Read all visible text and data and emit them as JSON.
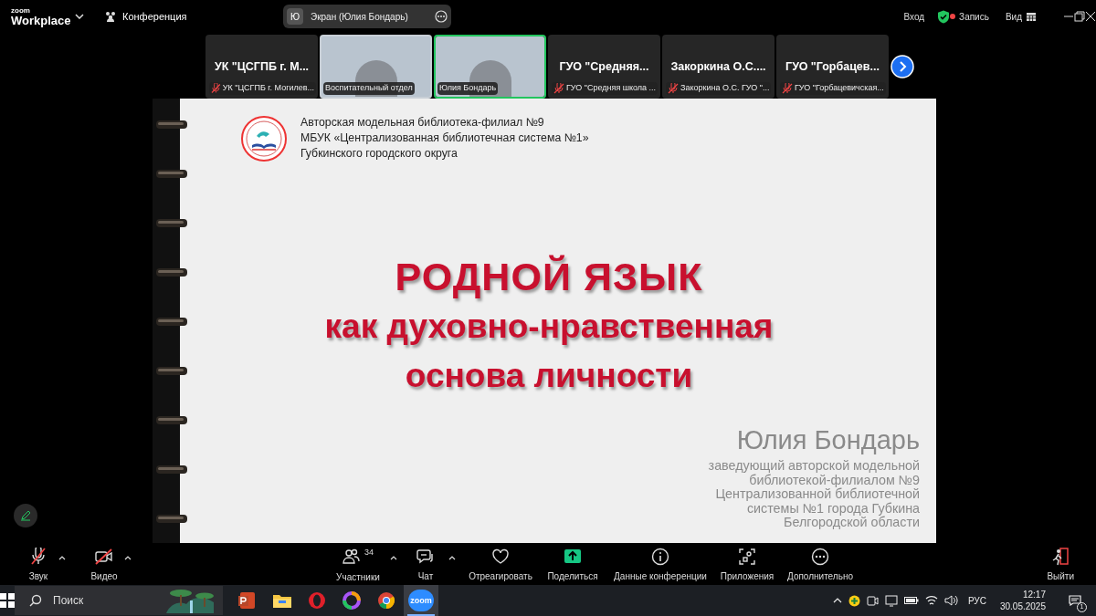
{
  "window": {
    "logo_top": "zoom",
    "logo_bottom": "Workplace",
    "meeting_menu": "Конференция"
  },
  "share_pill": {
    "avatar": "Ю",
    "label": "Экран (Юлия Бондарь)"
  },
  "top_actions": {
    "sign_in": "Вход",
    "recording": "Запись",
    "view": "Вид"
  },
  "participants": [
    {
      "kind": "name",
      "display": "УК \"ЦСГПБ г. М...",
      "label": "УК \"ЦСГПБ г. Могилев...",
      "muted": true,
      "speaking": false
    },
    {
      "kind": "video",
      "label": "Воспитательный отдел",
      "muted": false,
      "speaking": false
    },
    {
      "kind": "video",
      "label": "Юлия Бондарь",
      "muted": false,
      "speaking": true
    },
    {
      "kind": "name",
      "display": "ГУО \"Средняя...",
      "label": "ГУО \"Средняя школа ...",
      "muted": true,
      "speaking": false
    },
    {
      "kind": "name",
      "display": "Закоркина О.С....",
      "label": "Закоркина О.С. ГУО \"...",
      "muted": true,
      "speaking": false
    },
    {
      "kind": "name",
      "display": "ГУО \"Горбацев...",
      "label": "ГУО \"Горбацевичская...",
      "muted": true,
      "speaking": false
    }
  ],
  "slide": {
    "header": [
      "Авторская модельная библиотека-филиал №9",
      "МБУК «Централизованная библиотечная система №1»",
      "Губкинского городского округа"
    ],
    "title": [
      "РОДНОЙ ЯЗЫК",
      "как духовно-нравственная",
      "основа личности"
    ],
    "author": "Юлия Бондарь",
    "role": [
      "заведующий авторской модельной",
      "библиотекой-филиалом №9",
      "Централизованной библиотечной",
      "системы №1 города Губкина",
      "Белгородской области"
    ]
  },
  "toolbar": {
    "left": [
      {
        "kind": "mic",
        "label": "Звук",
        "off": true
      },
      {
        "kind": "camera",
        "label": "Видео",
        "off": true
      }
    ],
    "center": [
      {
        "kind": "people",
        "label": "Участники",
        "badge": "34",
        "caret": true
      },
      {
        "kind": "chat",
        "label": "Чат",
        "caret": true
      },
      {
        "kind": "heart",
        "label": "Отреагировать"
      },
      {
        "kind": "share",
        "label": "Поделиться"
      },
      {
        "kind": "info",
        "label": "Данные конференции"
      },
      {
        "kind": "apps",
        "label": "Приложения"
      },
      {
        "kind": "more",
        "label": "Дополнительно"
      }
    ],
    "leave": "Выйти"
  },
  "taskbar": {
    "search": "Поиск",
    "apps": [
      {
        "kind": "ppt",
        "selected": false
      },
      {
        "kind": "folder",
        "selected": false
      },
      {
        "kind": "opera",
        "selected": false
      },
      {
        "kind": "ring",
        "selected": false
      },
      {
        "kind": "chrome",
        "selected": false
      },
      {
        "kind": "zoom",
        "selected": true
      }
    ],
    "zoom_icon_text": "zoom",
    "language": "РУС",
    "time": "12:17",
    "date": "30.05.2025",
    "notifications": "1"
  }
}
